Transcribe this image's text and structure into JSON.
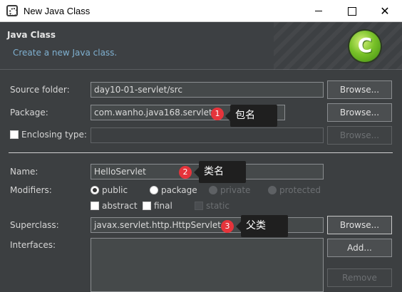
{
  "window": {
    "title": "New Java Class",
    "minimize": "–",
    "maximize": "□",
    "close": "✕"
  },
  "banner": {
    "title": "Java Class",
    "description": "Create a new Java class.",
    "icon_letter": "C"
  },
  "form": {
    "source_folder": {
      "label": "Source folder:",
      "value": "day10-01-servlet/src",
      "button": "Browse..."
    },
    "package": {
      "label": "Package:",
      "value": "com.wanho.java168.servlet",
      "button": "Browse..."
    },
    "enclosing_type": {
      "label": "Enclosing type:",
      "value": "",
      "button": "Browse...",
      "checked": false
    },
    "name": {
      "label": "Name:",
      "value": "HelloServlet"
    },
    "modifiers": {
      "label": "Modifiers:",
      "visibility": [
        {
          "label": "public",
          "selected": true,
          "enabled": true
        },
        {
          "label": "package",
          "selected": false,
          "enabled": true
        },
        {
          "label": "private",
          "selected": false,
          "enabled": false
        },
        {
          "label": "protected",
          "selected": false,
          "enabled": false
        }
      ],
      "flags": [
        {
          "label": "abstract",
          "checked": false,
          "enabled": true
        },
        {
          "label": "final",
          "checked": false,
          "enabled": true
        },
        {
          "label": "static",
          "checked": false,
          "enabled": false
        }
      ]
    },
    "superclass": {
      "label": "Superclass:",
      "value": "javax.servlet.http.HttpServlet",
      "button": "Browse..."
    },
    "interfaces": {
      "label": "Interfaces:",
      "add_button": "Add...",
      "remove_button": "Remove",
      "items": []
    }
  },
  "annotations": [
    {
      "number": "1",
      "text": "包名"
    },
    {
      "number": "2",
      "text": "类名"
    },
    {
      "number": "3",
      "text": "父类"
    }
  ],
  "colors": {
    "background": "#3c3f41",
    "field": "#45494a",
    "link_text": "#7fb0d0",
    "badge": "#e5343b",
    "callout": "#1f1f1f"
  }
}
